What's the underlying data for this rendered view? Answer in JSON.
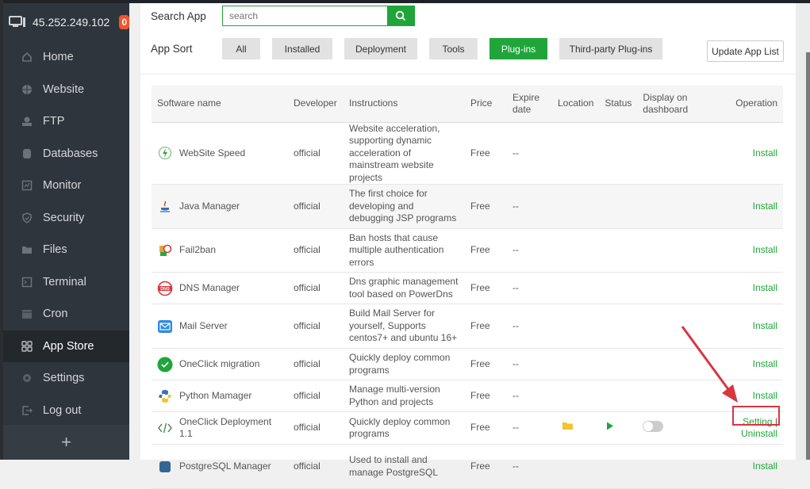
{
  "sidebar": {
    "server_ip": "45.252.249.102",
    "badge_count": "0",
    "items": [
      {
        "label": "Home",
        "icon": "home-icon"
      },
      {
        "label": "Website",
        "icon": "globe-icon"
      },
      {
        "label": "FTP",
        "icon": "ftp-icon"
      },
      {
        "label": "Databases",
        "icon": "database-icon"
      },
      {
        "label": "Monitor",
        "icon": "monitor-icon"
      },
      {
        "label": "Security",
        "icon": "shield-icon"
      },
      {
        "label": "Files",
        "icon": "folder-icon"
      },
      {
        "label": "Terminal",
        "icon": "terminal-icon"
      },
      {
        "label": "Cron",
        "icon": "calendar-icon"
      },
      {
        "label": "App Store",
        "icon": "grid-icon",
        "active": true
      },
      {
        "label": "Settings",
        "icon": "gear-icon"
      },
      {
        "label": "Log out",
        "icon": "logout-icon"
      }
    ],
    "add_label": "+"
  },
  "search": {
    "label": "Search App",
    "placeholder": "search"
  },
  "sort": {
    "label": "App Sort",
    "options": [
      "All",
      "Installed",
      "Deployment",
      "Tools",
      "Plug-ins",
      "Third-party Plug-ins"
    ],
    "selected": "Plug-ins"
  },
  "update_button": "Update App List",
  "table": {
    "headers": [
      "Software name",
      "Developer",
      "Instructions",
      "Price",
      "Expire date",
      "Location",
      "Status",
      "Display on dashboard",
      "Operation"
    ],
    "rows": [
      {
        "name": "WebSite Speed",
        "developer": "official",
        "instructions": "Website acceleration, supporting dynamic acceleration of mainstream website projects",
        "price": "Free",
        "expire": "--",
        "operation": "Install"
      },
      {
        "name": "Java Manager",
        "developer": "official",
        "instructions": "The first choice for developing and debugging JSP programs",
        "price": "Free",
        "expire": "--",
        "operation": "Install"
      },
      {
        "name": "Fail2ban",
        "developer": "official",
        "instructions": "Ban hosts that cause multiple authentication errors",
        "price": "Free",
        "expire": "--",
        "operation": "Install"
      },
      {
        "name": "DNS Manager",
        "developer": "official",
        "instructions": "Dns graphic management tool based on PowerDns",
        "price": "Free",
        "expire": "--",
        "operation": "Install"
      },
      {
        "name": "Mail Server",
        "developer": "official",
        "instructions": "Build Mail Server for yourself, Supports centos7+ and ubuntu 16+",
        "price": "Free",
        "expire": "--",
        "operation": "Install"
      },
      {
        "name": "OneClick migration",
        "developer": "official",
        "instructions": "Quickly deploy common programs",
        "price": "Free",
        "expire": "--",
        "operation": "Install"
      },
      {
        "name": "Python Mamager",
        "developer": "official",
        "instructions": "Manage multi-version Python and projects",
        "price": "Free",
        "expire": "--",
        "operation": "Install"
      },
      {
        "name": "OneClick Deployment 1.1",
        "developer": "official",
        "instructions": "Quickly deploy common programs",
        "price": "Free",
        "expire": "--",
        "operation_setting": "Setting",
        "operation_sep": "|",
        "operation_uninstall": "Uninstall",
        "installed": true,
        "dashboard_enabled": false
      },
      {
        "name": "PostgreSQL Manager",
        "developer": "official",
        "instructions": "Used to install and manage PostgreSQL",
        "price": "Free",
        "expire": "--",
        "operation": "Install"
      }
    ]
  },
  "colors": {
    "accent": "#20a53a",
    "sidebar_bg": "#2f353d",
    "badge": "#f0552b",
    "annotation": "#d9363e"
  }
}
